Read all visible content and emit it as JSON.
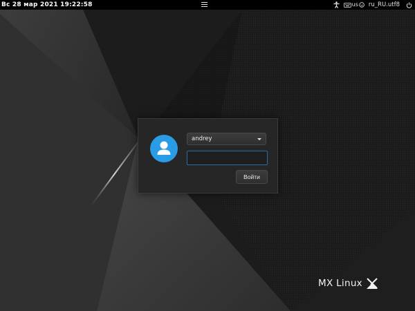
{
  "panel": {
    "clock": "Вс 28 мар 2021 19:22:58",
    "menu_icon": "hamburger-menu-icon",
    "accessibility_icon": "accessibility-icon",
    "keyboard_icon": "keyboard-icon",
    "keyboard_layout": "us",
    "smiley_icon": "smiley-icon",
    "locale": "ru_RU.utf8",
    "power_icon": "power-icon"
  },
  "login": {
    "avatar_icon": "user-avatar-icon",
    "username": "andrey",
    "password_value": "",
    "button_label": "Войти",
    "accent_color": "#2a9be5"
  },
  "branding": {
    "logo_text": "MX Linux"
  }
}
